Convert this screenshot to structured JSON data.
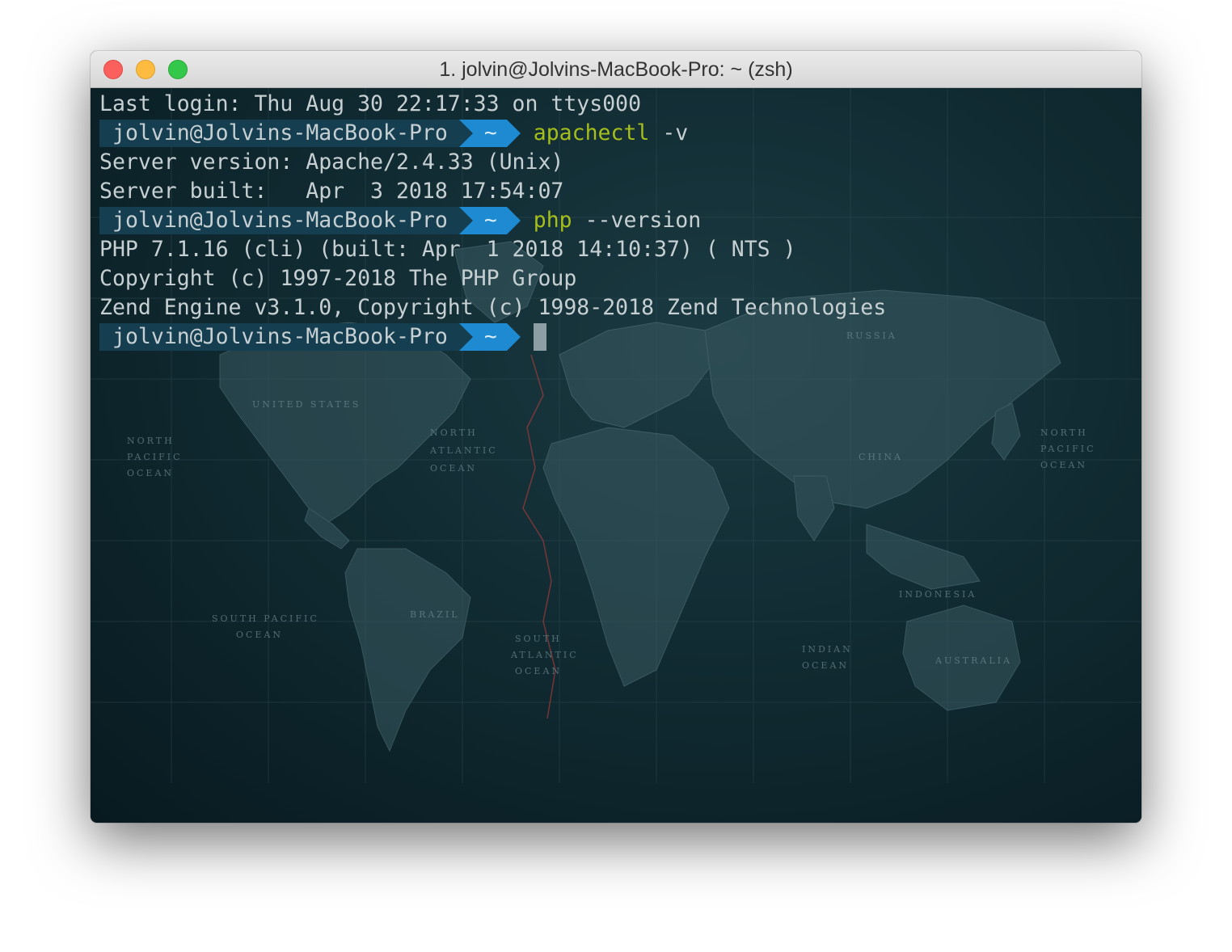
{
  "window": {
    "title": "1. jolvin@Jolvins-MacBook-Pro: ~ (zsh)",
    "buttons": {
      "close": "close-button",
      "minimize": "minimize-button",
      "zoom": "zoom-button"
    }
  },
  "prompt": {
    "user": "jolvin@Jolvins-MacBook-Pro",
    "dir": "~"
  },
  "terminal": {
    "last_login": "Last login: Thu Aug 30 22:17:33 on ttys000",
    "cmd1": {
      "name": "apachectl",
      "args": " -v"
    },
    "apache_version": "Server version: Apache/2.4.33 (Unix)",
    "apache_built": "Server built:   Apr  3 2018 17:54:07",
    "cmd2": {
      "name": "php",
      "args": " --version"
    },
    "php_version": "PHP 7.1.16 (cli) (built: Apr  1 2018 14:10:37) ( NTS )",
    "php_copyright": "Copyright (c) 1997-2018 The PHP Group",
    "zend_engine": "Zend Engine v3.1.0, Copyright (c) 1998-2018 Zend Technologies"
  },
  "colors": {
    "background": "#0b2128",
    "prompt_user_bg": "#153e50",
    "prompt_dir_bg": "#1e8ad2",
    "command": "#a6be1b",
    "text": "#c6cfd2"
  }
}
